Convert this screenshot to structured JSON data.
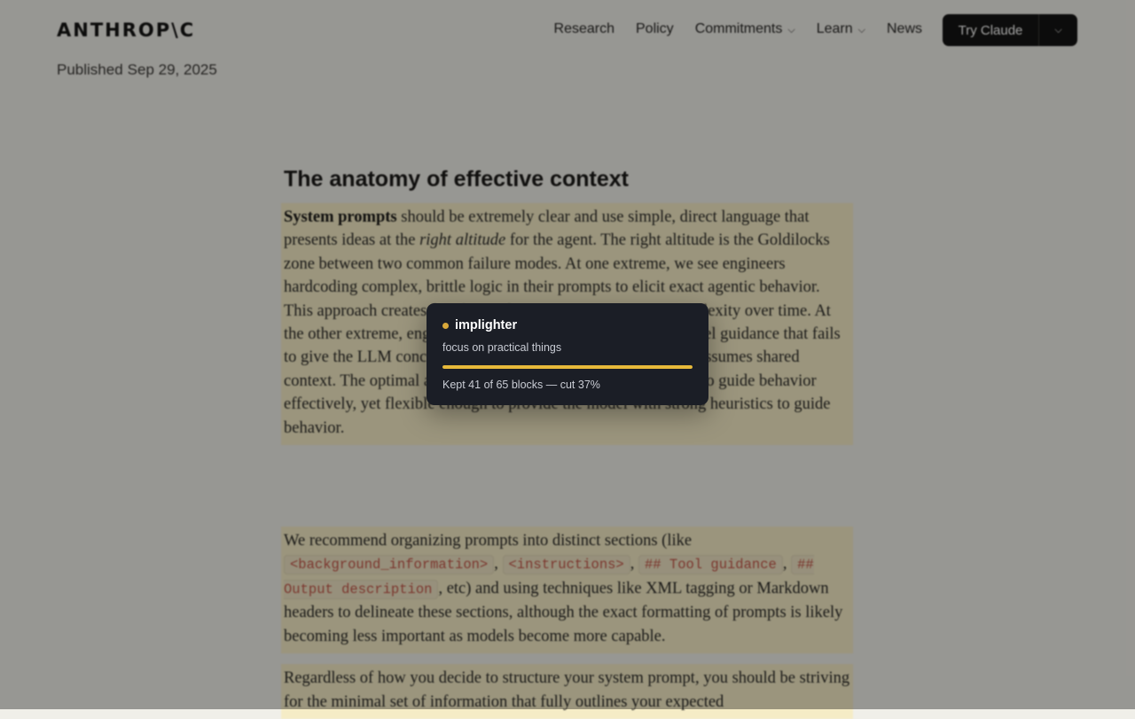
{
  "header": {
    "logo": "ANTHROP\\C",
    "nav": [
      "Research",
      "Policy",
      "Commitments",
      "Learn",
      "News"
    ],
    "cta": "Try Claude"
  },
  "meta": {
    "published_prefix": "Published",
    "published_date": "Sep 29, 2025"
  },
  "article": {
    "heading": "The anatomy of effective context",
    "p1": {
      "bold": "System prompts",
      "t1": " should be extremely clear and use simple, direct language that presents ideas at the ",
      "em": "right altitude",
      "t2": " for the agent. The right altitude is the Goldilocks zone between two common failure modes. At one extreme, we see engineers hardcoding complex, brittle logic in their prompts to elicit exact agentic behavior. This approach creates fragility and increases maintenance complexity over time. At the other extreme, engineers sometimes provide vague, high-level guidance that fails to give the LLM concrete signals for desired outputs or falsely assumes shared context. The optimal altitude strikes a balance: specific enough to guide behavior effectively, yet flexible enough to provide the model with strong heuristics to guide behavior."
    },
    "p2": {
      "t1": "We recommend organizing prompts into distinct sections (like ",
      "c1": "<background_information>",
      "c2": "<instructions>",
      "c3": "## Tool guidance",
      "c4": "## Output description",
      "t2": ", etc) and using techniques like XML tagging or Markdown headers to delineate these sections, although the exact formatting of prompts is likely becoming less important as models become more capable."
    },
    "p3": "Regardless of how you decide to structure your system prompt, you should be striving for the minimal set of information that fully outlines your expected"
  },
  "popup": {
    "title": "implighter",
    "subtitle": "focus on practical things",
    "progress": 1.0,
    "status": "Kept 41 of 65 blocks — cut 37%"
  },
  "colors": {
    "highlight": "#f5ecc6",
    "accent": "#e7b93a",
    "popup_bg": "#1b1e26"
  },
  "icons": {
    "nav_dropdown": "chevron-down-icon",
    "popup_marker": "dot-icon"
  }
}
